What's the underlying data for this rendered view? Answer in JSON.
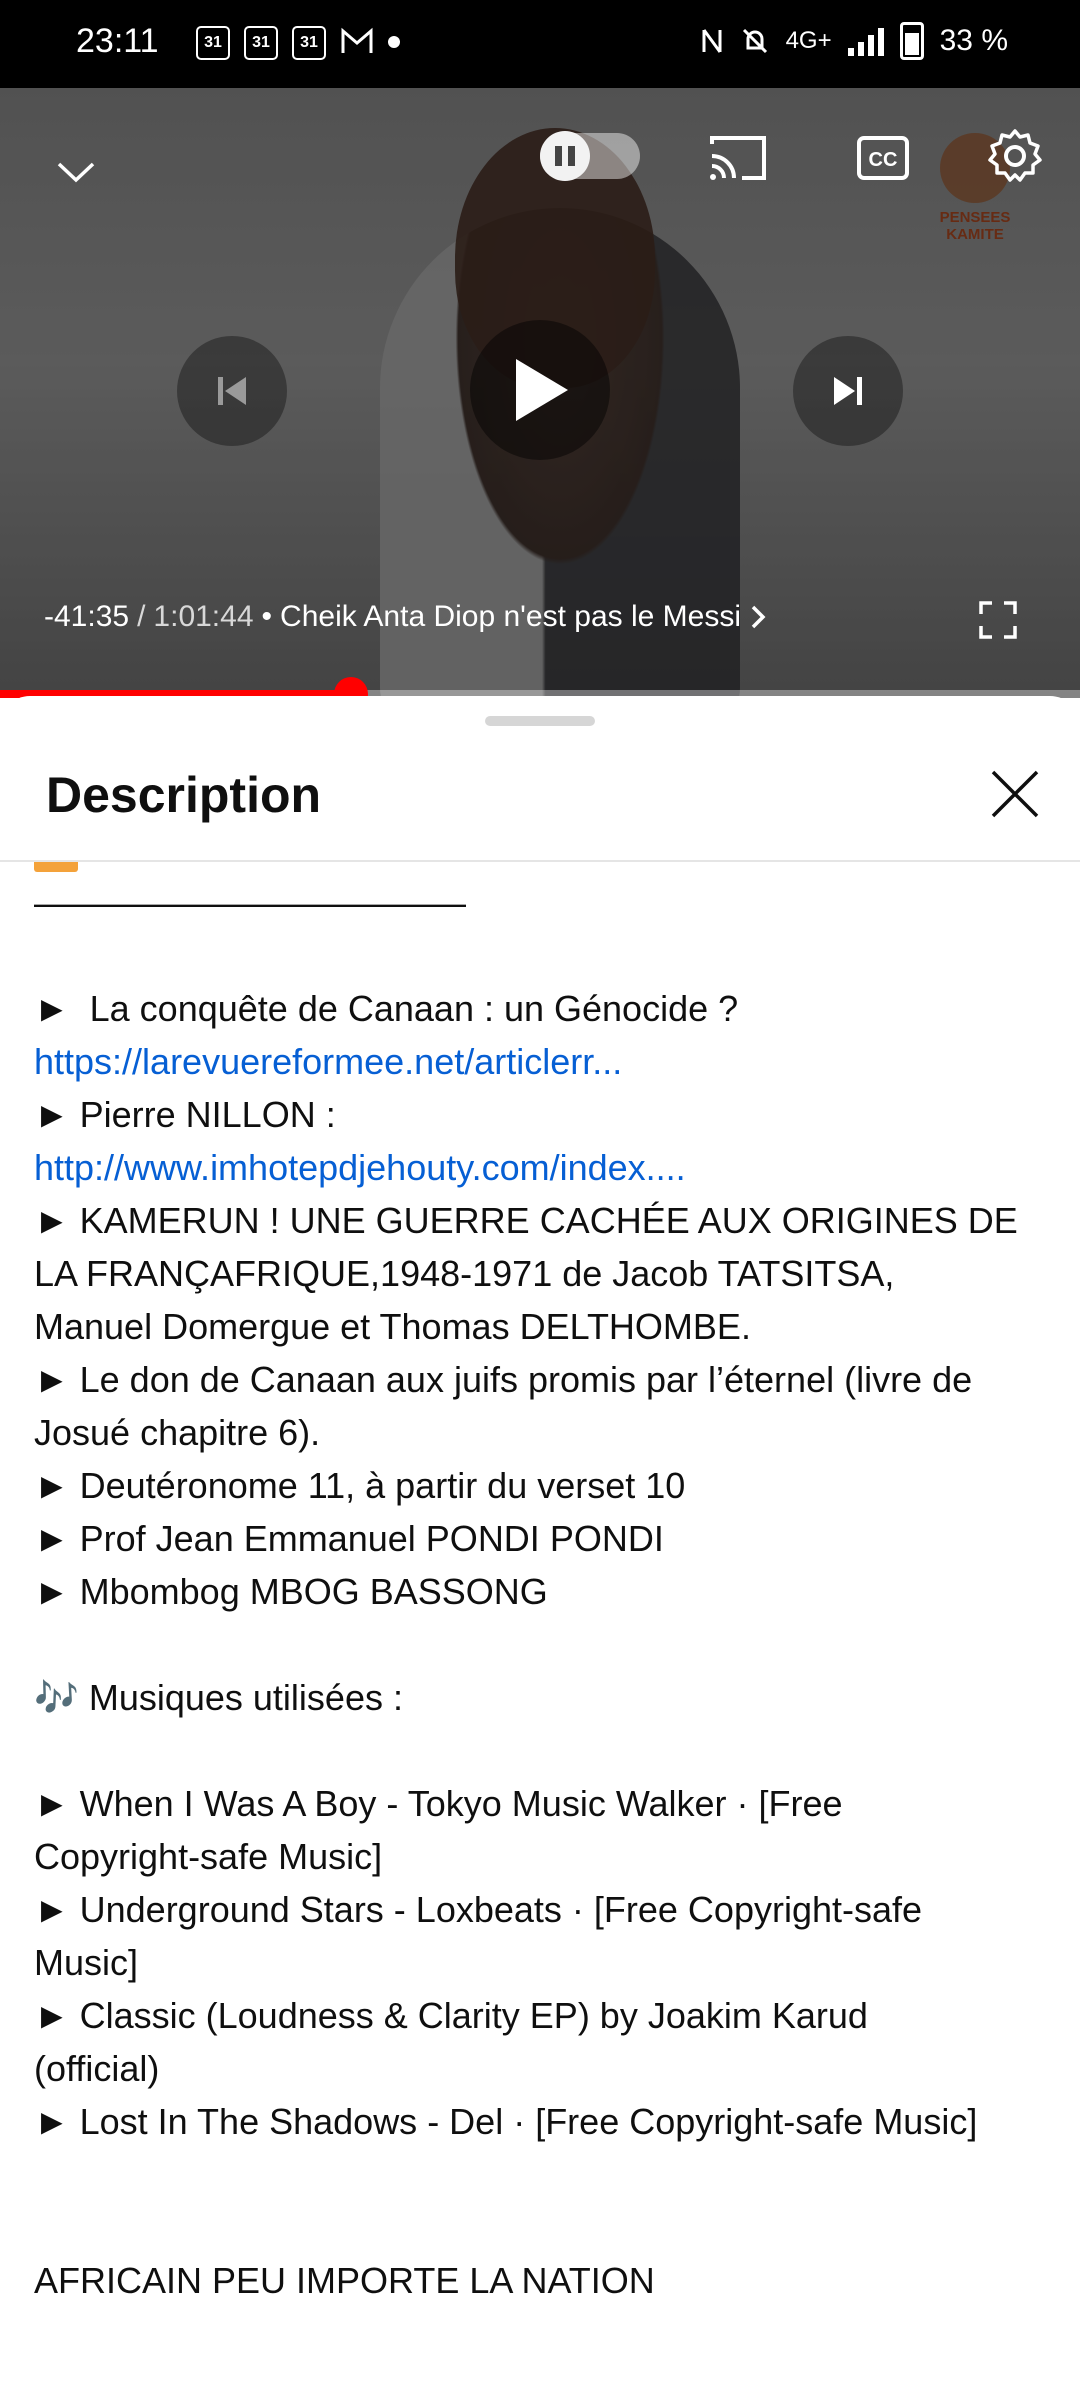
{
  "status_bar": {
    "time": "23:11",
    "calendar_badges": [
      "31",
      "31",
      "31"
    ],
    "network": "4G+",
    "battery": "33 %"
  },
  "player": {
    "elapsed": "-41:35",
    "separator": "/",
    "duration": "1:01:44",
    "chapter_prefix": "•",
    "chapter": "Cheik Anta Diop n'est pas le Messi",
    "progress": 0.325,
    "cc_label": "CC",
    "channel_logo_text": "PENSEES KAMITE"
  },
  "sheet": {
    "title": "Description",
    "lines": [
      {
        "type": "text",
        "text": "————————————"
      },
      {
        "type": "gap"
      },
      {
        "type": "text",
        "text": "►  La conquête de Canaan : un Génocide ?"
      },
      {
        "type": "link",
        "text": "https://larevuereformee.net/articlerr..."
      },
      {
        "type": "text",
        "text": "► Pierre NILLON :"
      },
      {
        "type": "link",
        "text": "http://www.imhotepdjehouty.com/index...."
      },
      {
        "type": "text",
        "text": "► KAMERUN ! UNE GUERRE CACHÉE AUX ORIGINES DE"
      },
      {
        "type": "text",
        "text": "LA FRANÇAFRIQUE,1948-1971 de Jacob TATSITSA,"
      },
      {
        "type": "text",
        "text": "Manuel Domergue et Thomas DELTHOMBE."
      },
      {
        "type": "text",
        "text": "► Le don de Canaan aux juifs promis par l’éternel (livre de"
      },
      {
        "type": "text",
        "text": "Josué chapitre 6)."
      },
      {
        "type": "text",
        "text": "► Deutéronome 11, à partir du verset 10"
      },
      {
        "type": "text",
        "text": "► Prof Jean Emmanuel PONDI PONDI"
      },
      {
        "type": "text",
        "text": "► Mbombog MBOG BASSONG"
      },
      {
        "type": "gap"
      },
      {
        "type": "text",
        "text": "🎶 Musiques utilisées :"
      },
      {
        "type": "gap"
      },
      {
        "type": "text",
        "text": "► When I Was A Boy - Tokyo Music Walker · [Free"
      },
      {
        "type": "text",
        "text": "Copyright-safe Music]"
      },
      {
        "type": "text",
        "text": "► Underground Stars - Loxbeats · [Free Copyright-safe"
      },
      {
        "type": "text",
        "text": "Music]"
      },
      {
        "type": "text",
        "text": "► Classic (Loudness & Clarity EP) by Joakim Karud"
      },
      {
        "type": "text",
        "text": "(official)"
      },
      {
        "type": "text",
        "text": "► Lost In The Shadows - Del · [Free Copyright-safe Music]"
      },
      {
        "type": "gap"
      },
      {
        "type": "gap"
      },
      {
        "type": "text",
        "text": "AFRICAIN PEU IMPORTE LA NATION"
      }
    ]
  },
  "colors": {
    "accent_red": "#ff0000",
    "link_blue": "#065fd4"
  }
}
